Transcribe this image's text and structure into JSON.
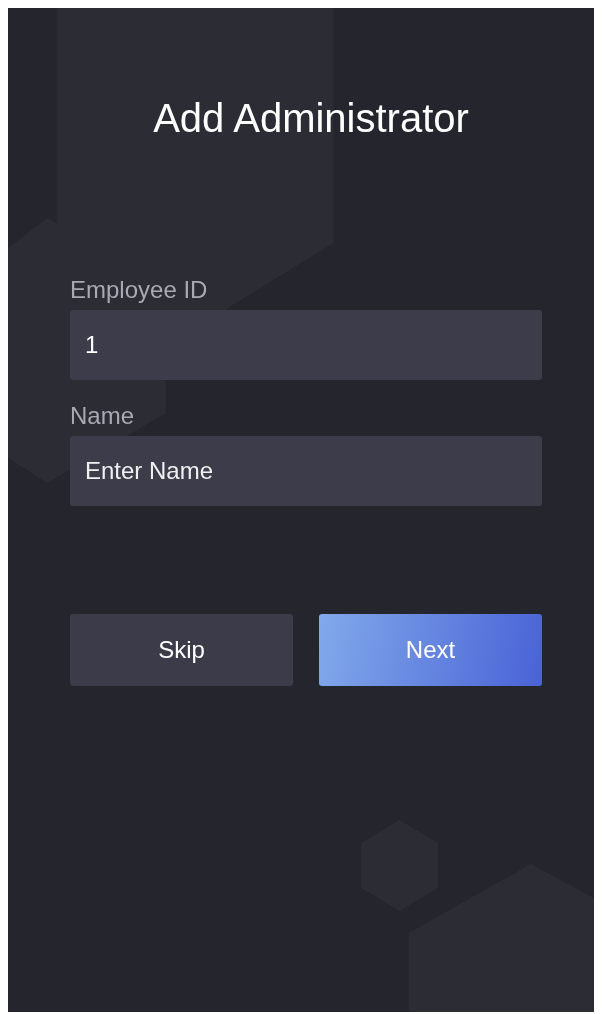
{
  "title": "Add Administrator",
  "fields": [
    {
      "kind": "value",
      "label": "Employee ID",
      "value": "1"
    },
    {
      "kind": "placeholder",
      "label": "Name",
      "placeholder": "Enter Name"
    }
  ],
  "buttons": [
    {
      "label": "Skip",
      "kind": "secondary"
    },
    {
      "label": "Next",
      "kind": "primary"
    }
  ]
}
